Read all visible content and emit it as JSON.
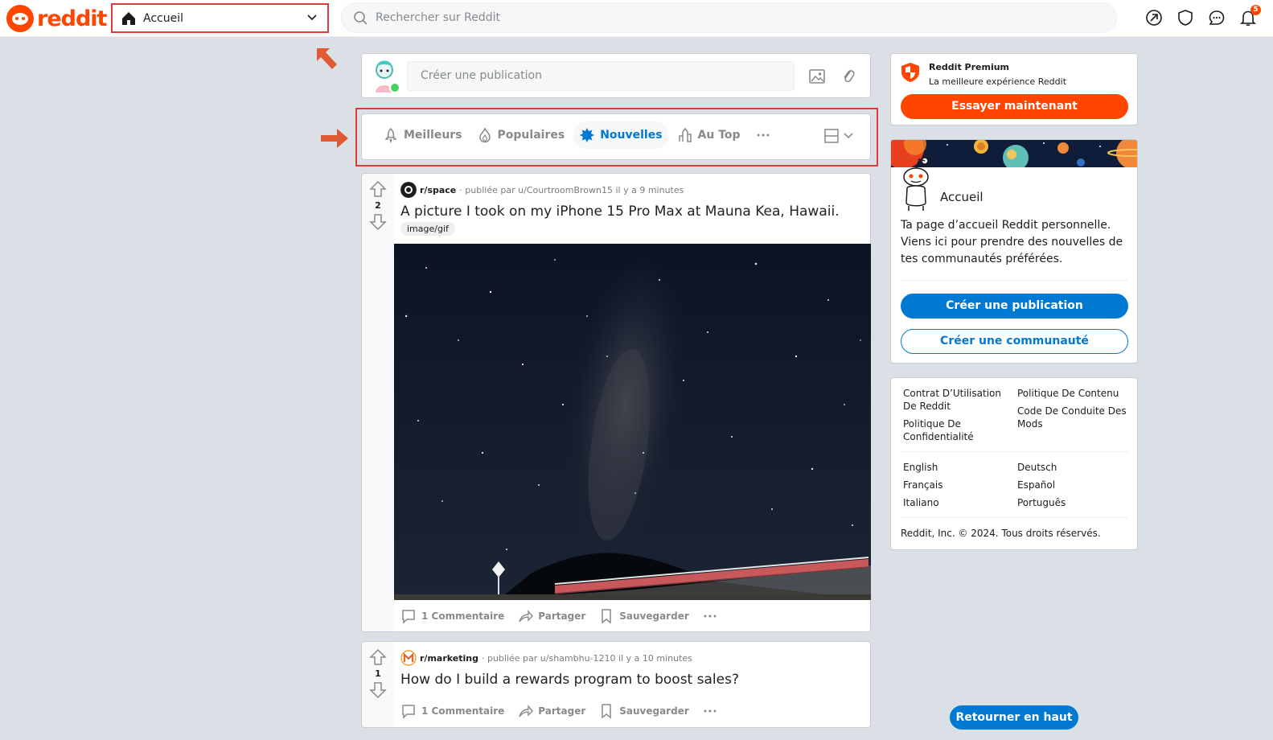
{
  "header": {
    "logo_text": "reddit",
    "home_label": "Accueil",
    "search_placeholder": "Rechercher sur Reddit",
    "notification_count": "5"
  },
  "create_post": {
    "placeholder": "Créer une publication"
  },
  "sort": {
    "items": [
      {
        "label": "Meilleurs",
        "icon": "rocket-icon",
        "active": false
      },
      {
        "label": "Populaires",
        "icon": "flame-icon",
        "active": false
      },
      {
        "label": "Nouvelles",
        "icon": "burst-icon",
        "active": true
      },
      {
        "label": "Au Top",
        "icon": "top-chart-icon",
        "active": false
      }
    ]
  },
  "posts": [
    {
      "subreddit": "r/space",
      "posted_by_prefix": "· publiée par",
      "author": "u/CourtroomBrown15",
      "time": "il y a 9 minutes",
      "votes": "2",
      "title": "A picture I took on my iPhone 15 Pro Max at Mauna Kea, Hawaii.",
      "flair": "image/gif",
      "comments": "1 Commentaire",
      "share": "Partager",
      "save": "Sauvegarder"
    },
    {
      "subreddit": "r/marketing",
      "posted_by_prefix": "· publiée par",
      "author": "u/shambhu-1210",
      "time": "il y a 10 minutes",
      "votes": "1",
      "title": "How do I build a rewards program to boost sales?",
      "comments": "1 Commentaire",
      "share": "Partager",
      "save": "Sauvegarder"
    }
  ],
  "sidebar": {
    "premium": {
      "title": "Reddit Premium",
      "subtitle": "La meilleure expérience Reddit",
      "button": "Essayer maintenant"
    },
    "home": {
      "title": "Accueil",
      "description": "Ta page d’accueil Reddit personnelle. Viens ici pour prendre des nouvelles de tes communautés préférées.",
      "create_post": "Créer une publication",
      "create_community": "Créer une communauté"
    },
    "links": {
      "policy": [
        "Contrat D’Utilisation De Reddit",
        "Politique De Contenu",
        "Politique De Confidentialité",
        "Code De Conduite Des Mods"
      ],
      "languages": [
        "English",
        "Deutsch",
        "Français",
        "Español",
        "Italiano",
        "Português"
      ],
      "copyright": "Reddit, Inc. © 2024. Tous droits réservés."
    }
  },
  "back_to_top": "Retourner en haut",
  "colors": {
    "brand": "#ff4500",
    "accent": "#0079d3",
    "annotation": "#d93a3a"
  }
}
